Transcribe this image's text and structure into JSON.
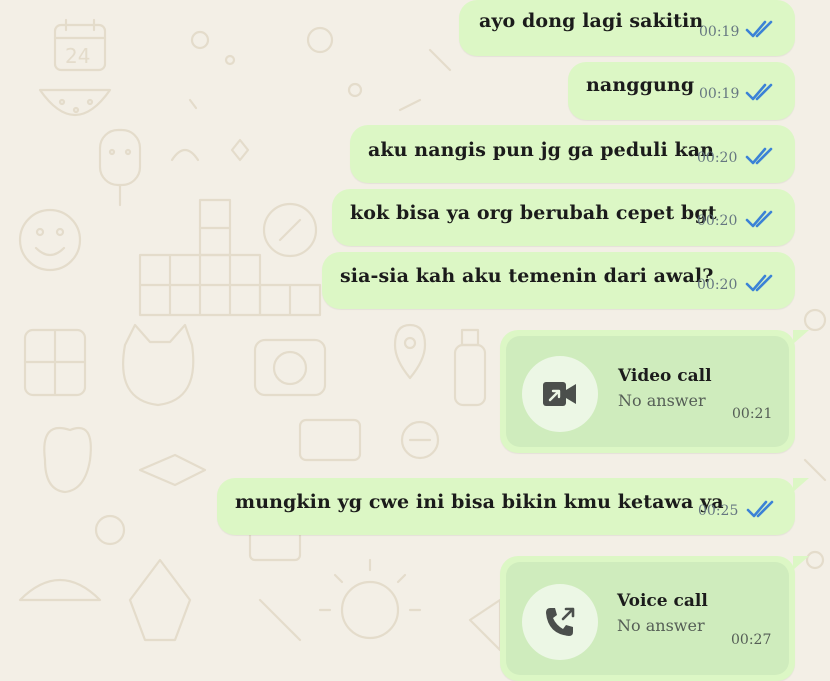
{
  "theme": {
    "bubble_color": "#dcf7c5",
    "call_card_color": "#cfecbd",
    "tick_color": "#3b82d6",
    "wallpaper_color": "#f3efe6"
  },
  "messages": [
    {
      "text": "ayo dong lagi sakitin",
      "time": "00:19",
      "status_icon": "double-check-read-icon"
    },
    {
      "text": "nanggung",
      "time": "00:19",
      "status_icon": "double-check-read-icon"
    },
    {
      "text": "aku nangis pun jg ga peduli kan",
      "time": "00:20",
      "status_icon": "double-check-read-icon"
    },
    {
      "text": "kok bisa ya org berubah cepet bgt",
      "time": "00:20",
      "status_icon": "double-check-read-icon"
    },
    {
      "text": "sia-sia kah aku temenin dari awal?",
      "time": "00:20",
      "status_icon": "double-check-read-icon"
    },
    {
      "text": "mungkin yg cwe ini bisa bikin kmu ketawa ya",
      "time": "00:25",
      "status_icon": "double-check-read-icon"
    }
  ],
  "calls": [
    {
      "title": "Video call",
      "status": "No answer",
      "time": "00:21",
      "icon": "video-call-icon"
    },
    {
      "title": "Voice call",
      "status": "No answer",
      "time": "00:27",
      "icon": "outgoing-voice-call-icon"
    }
  ]
}
